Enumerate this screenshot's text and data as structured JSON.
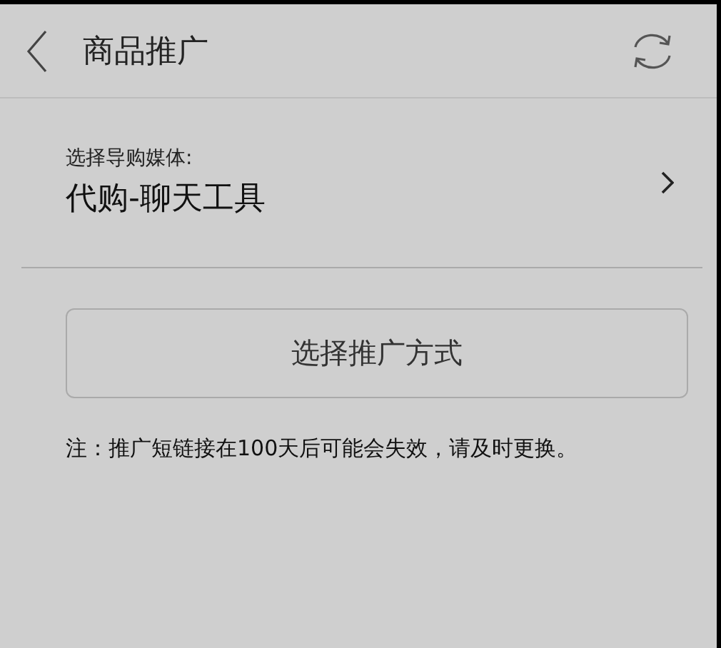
{
  "header": {
    "title": "商品推广"
  },
  "media": {
    "label": "选择导购媒体:",
    "value": "代购-聊天工具"
  },
  "button": {
    "label": "选择推广方式"
  },
  "note": "注：推广短链接在100天后可能会失效，请及时更换。"
}
